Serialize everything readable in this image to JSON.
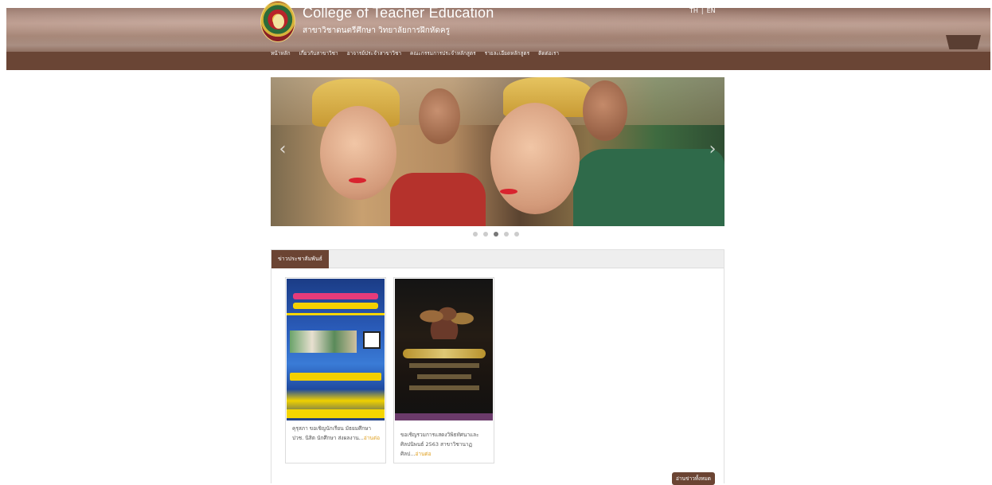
{
  "header": {
    "title": "College of Teacher Education",
    "subtitle": "สาขาวิชาดนตรีศึกษา วิทยาลัยการฝึกหัดครู",
    "lang": {
      "th": "TH",
      "separator": "|",
      "en": "EN"
    }
  },
  "nav": {
    "items": [
      {
        "label": "หน้าหลัก"
      },
      {
        "label": "เกี่ยวกับสาขาวิชา"
      },
      {
        "label": "อาจารย์ประจำสาขาวิชา"
      },
      {
        "label": "คณะกรรมการประจำหลักสูตร"
      },
      {
        "label": "รายละเอียดหลักสูตร"
      },
      {
        "label": "ติดต่อเรา"
      }
    ]
  },
  "slider": {
    "prev_arrow": "‹",
    "next_arrow": "›",
    "slide_count": 5,
    "active_index": 2
  },
  "news": {
    "tab_label": "ข่าวประชาสัมพันธ์",
    "cards": [
      {
        "caption": "คุรุสภา ขอเชิญนักเรียน มัธยมศึกษา ปวช. นิสิต นักศึกษา ส่งผลงาน...",
        "read_more": "อ่านต่อ"
      },
      {
        "caption": "ขอเชิญรวมการแสดงวิพิธทัศนาและ ศิลปนิพนธ์ 2563 สาขาวิชานาฏ ศิลป...",
        "read_more": "อ่านต่อ"
      }
    ],
    "all_button": "อ่านข่าวทั้งหมด"
  },
  "colors": {
    "brand_brown": "#6b4433",
    "read_more": "#e0a020",
    "dot_active": "#777777",
    "dot_inactive": "#cccccc"
  }
}
